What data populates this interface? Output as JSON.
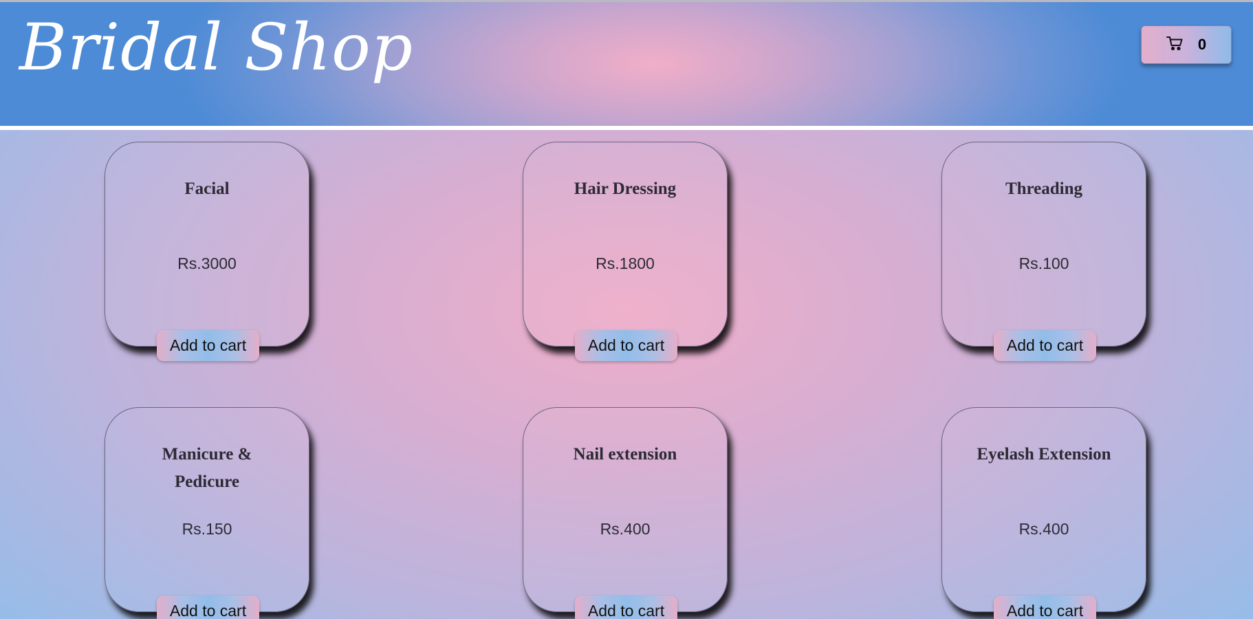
{
  "header": {
    "brand": "Bridal Shop",
    "cart_icon": "cart-icon",
    "cart_count": "0"
  },
  "services": [
    {
      "name": "Facial",
      "price": "Rs.3000",
      "button": "Add to cart"
    },
    {
      "name": "Hair Dressing",
      "price": "Rs.1800",
      "button": "Add to cart"
    },
    {
      "name": "Threading",
      "price": "Rs.100",
      "button": "Add to cart"
    },
    {
      "name": "Manicure & Pedicure",
      "price": "Rs.150",
      "button": "Add to cart"
    },
    {
      "name": "Nail extension",
      "price": "Rs.400",
      "button": "Add to cart"
    },
    {
      "name": "Eyelash Extension",
      "price": "Rs.400",
      "button": "Add to cart"
    }
  ],
  "colors": {
    "header_edge": "#4d8bd6",
    "header_center": "#f1aec8",
    "page_edge": "#98bce8",
    "page_center": "#efaec9"
  }
}
